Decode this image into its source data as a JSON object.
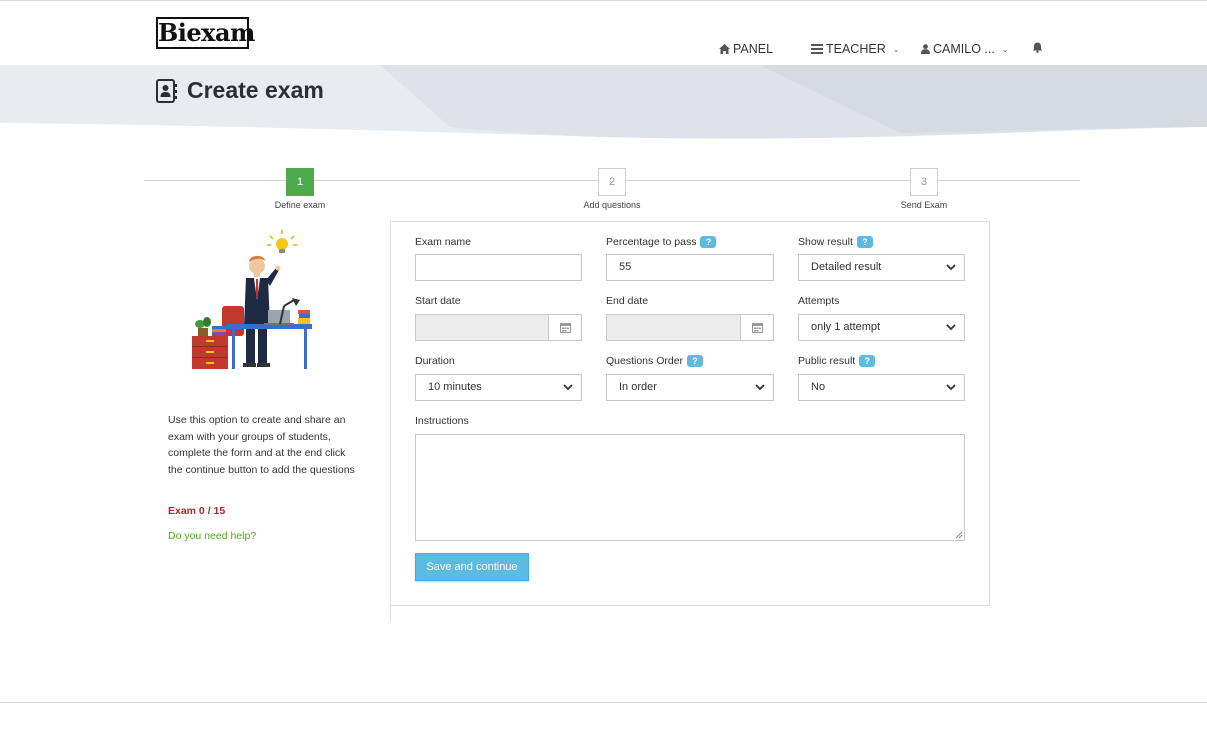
{
  "brand": {
    "logo_text": "Biexam"
  },
  "nav": {
    "panel_label": "PANEL",
    "teacher_label": "TEACHER",
    "user_label": "CAMILO ...",
    "icons": [
      "home-icon",
      "list-icon",
      "user-icon",
      "bell-icon"
    ]
  },
  "header": {
    "title": "Create exam",
    "icon": "contact-book-icon"
  },
  "steps": [
    {
      "number": "1",
      "label": "Define exam",
      "active": true
    },
    {
      "number": "2",
      "label": "Add questions",
      "active": false
    },
    {
      "number": "3",
      "label": "Send Exam",
      "active": false
    }
  ],
  "sidebar": {
    "description": "Use this option to create and share an exam with your groups of students, complete the form and at the end click the continue button to add the questions",
    "exam_count": "Exam 0 / 15",
    "help_link": "Do you need help?"
  },
  "form": {
    "exam_name": {
      "label": "Exam name",
      "value": ""
    },
    "percentage": {
      "label": "Percentage to pass",
      "value": "55",
      "help_icon": "?"
    },
    "show_result": {
      "label": "Show result",
      "value": "Detailed result",
      "help_icon": "?"
    },
    "start_date": {
      "label": "Start date",
      "value": ""
    },
    "end_date": {
      "label": "End date",
      "value": ""
    },
    "attempts": {
      "label": "Attempts",
      "value": "only 1 attempt"
    },
    "duration": {
      "label": "Duration",
      "value": "10 minutes"
    },
    "questions_order": {
      "label": "Questions Order",
      "value": "In order",
      "help_icon": "?"
    },
    "public_result": {
      "label": "Public result",
      "value": "No",
      "help_icon": "?"
    },
    "instructions": {
      "label": "Instructions",
      "value": ""
    },
    "submit_label": "Save and continue"
  },
  "colors": {
    "accent": "#5bbbe0",
    "step_active": "#4caa4c",
    "exam_count": "#a52a2a",
    "help_link": "#4caa1c",
    "banner": "#e4e8ee"
  }
}
